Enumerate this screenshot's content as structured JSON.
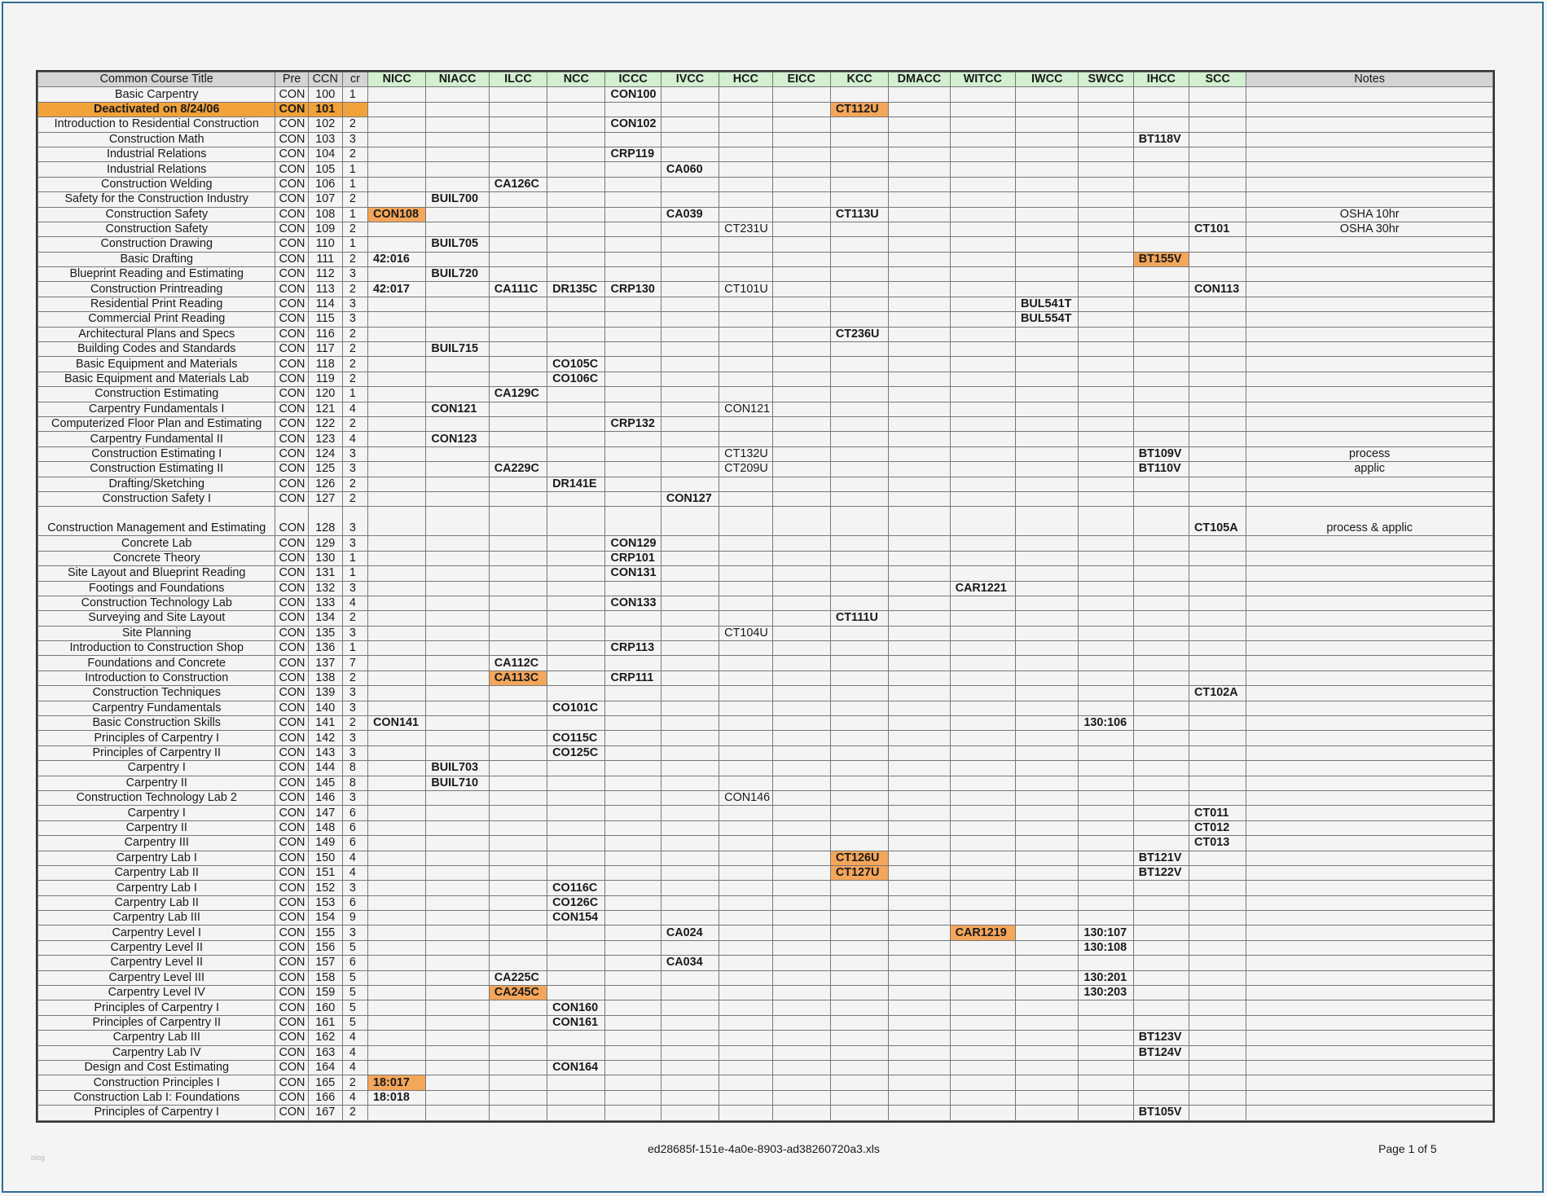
{
  "columns": {
    "title": "Common Course Title",
    "pre": "Pre",
    "ccn": "CCN",
    "cr": "cr",
    "colleges": [
      "NICC",
      "NIACC",
      "ILCC",
      "NCC",
      "ICCC",
      "IVCC",
      "HCC",
      "EICC",
      "KCC",
      "DMACC",
      "WITCC",
      "IWCC",
      "SWCC",
      "IHCC",
      "SCC"
    ],
    "notes": "Notes"
  },
  "rows": [
    {
      "title": "Basic Carpentry",
      "pre": "CON",
      "ccn": "100",
      "cr": "1",
      "ICCC": "CON100"
    },
    {
      "title": "Deactivated on 8/24/06",
      "pre": "CON",
      "ccn": "101",
      "cr": "",
      "KCC": "CT112U",
      "deactivated": true,
      "hl": [
        "KCC"
      ]
    },
    {
      "title": "Introduction to Residential Construction",
      "pre": "CON",
      "ccn": "102",
      "cr": "2",
      "ICCC": "CON102"
    },
    {
      "title": "Construction Math",
      "pre": "CON",
      "ccn": "103",
      "cr": "3",
      "IHCC": "BT118V"
    },
    {
      "title": "Industrial Relations",
      "pre": "CON",
      "ccn": "104",
      "cr": "2",
      "ICCC": "CRP119"
    },
    {
      "title": "Industrial Relations",
      "pre": "CON",
      "ccn": "105",
      "cr": "1",
      "IVCC": "CA060"
    },
    {
      "title": "Construction Welding",
      "pre": "CON",
      "ccn": "106",
      "cr": "1",
      "ILCC": "CA126C"
    },
    {
      "title": "Safety for the Construction Industry",
      "pre": "CON",
      "ccn": "107",
      "cr": "2",
      "NIACC": "BUIL700"
    },
    {
      "title": "Construction Safety",
      "pre": "CON",
      "ccn": "108",
      "cr": "1",
      "NICC": "CON108",
      "IVCC": "CA039",
      "KCC": "CT113U",
      "notes": "OSHA 10hr",
      "hl": [
        "NICC"
      ]
    },
    {
      "title": "Construction Safety",
      "pre": "CON",
      "ccn": "109",
      "cr": "2",
      "HCC": "CT231U",
      "SCC": "CT101",
      "notes": "OSHA 30hr",
      "plain": [
        "HCC"
      ]
    },
    {
      "title": "Construction Drawing",
      "pre": "CON",
      "ccn": "110",
      "cr": "1",
      "NIACC": "BUIL705"
    },
    {
      "title": "Basic Drafting",
      "pre": "CON",
      "ccn": "111",
      "cr": "2",
      "NICC": "42:016",
      "IHCC": "BT155V",
      "hl": [
        "IHCC"
      ]
    },
    {
      "title": "Blueprint Reading and Estimating",
      "pre": "CON",
      "ccn": "112",
      "cr": "3",
      "NIACC": "BUIL720"
    },
    {
      "title": "Construction Printreading",
      "pre": "CON",
      "ccn": "113",
      "cr": "2",
      "NICC": "42:017",
      "ILCC": "CA111C",
      "NCC": "DR135C",
      "ICCC": "CRP130",
      "HCC": "CT101U",
      "SCC": "CON113",
      "plain": [
        "HCC"
      ]
    },
    {
      "title": "Residential Print Reading",
      "pre": "CON",
      "ccn": "114",
      "cr": "3",
      "IWCC": "BUL541T"
    },
    {
      "title": "Commercial Print Reading",
      "pre": "CON",
      "ccn": "115",
      "cr": "3",
      "IWCC": "BUL554T"
    },
    {
      "title": "Architectural Plans and Specs",
      "pre": "CON",
      "ccn": "116",
      "cr": "2",
      "KCC": "CT236U"
    },
    {
      "title": "Building Codes and Standards",
      "pre": "CON",
      "ccn": "117",
      "cr": "2",
      "NIACC": "BUIL715"
    },
    {
      "title": "Basic Equipment and Materials",
      "pre": "CON",
      "ccn": "118",
      "cr": "2",
      "NCC": "CO105C"
    },
    {
      "title": "Basic Equipment and Materials Lab",
      "pre": "CON",
      "ccn": "119",
      "cr": "2",
      "NCC": "CO106C"
    },
    {
      "title": "Construction Estimating",
      "pre": "CON",
      "ccn": "120",
      "cr": "1",
      "ILCC": "CA129C"
    },
    {
      "title": "Carpentry Fundamentals I",
      "pre": "CON",
      "ccn": "121",
      "cr": "4",
      "NIACC": "CON121",
      "HCC": "CON121",
      "plain": [
        "HCC"
      ]
    },
    {
      "title": "Computerized Floor Plan and Estimating",
      "pre": "CON",
      "ccn": "122",
      "cr": "2",
      "ICCC": "CRP132"
    },
    {
      "title": "Carpentry Fundamental II",
      "pre": "CON",
      "ccn": "123",
      "cr": "4",
      "NIACC": "CON123"
    },
    {
      "title": "Construction Estimating I",
      "pre": "CON",
      "ccn": "124",
      "cr": "3",
      "HCC": "CT132U",
      "IHCC": "BT109V",
      "notes": "process",
      "plain": [
        "HCC"
      ]
    },
    {
      "title": "Construction Estimating II",
      "pre": "CON",
      "ccn": "125",
      "cr": "3",
      "ILCC": "CA229C",
      "HCC": "CT209U",
      "IHCC": "BT110V",
      "notes": "applic",
      "plain": [
        "HCC"
      ]
    },
    {
      "title": "Drafting/Sketching",
      "pre": "CON",
      "ccn": "126",
      "cr": "2",
      "NCC": "DR141E"
    },
    {
      "title": "Construction Safety I",
      "pre": "CON",
      "ccn": "127",
      "cr": "2",
      "IVCC": "CON127"
    },
    {
      "title": "Construction Management and Estimating",
      "pre": "CON",
      "ccn": "128",
      "cr": "3",
      "SCC": "CT105A",
      "notes": "process & applic",
      "tall": true
    },
    {
      "title": "Concrete Lab",
      "pre": "CON",
      "ccn": "129",
      "cr": "3",
      "ICCC": "CON129"
    },
    {
      "title": "Concrete Theory",
      "pre": "CON",
      "ccn": "130",
      "cr": "1",
      "ICCC": "CRP101"
    },
    {
      "title": "Site Layout and Blueprint Reading",
      "pre": "CON",
      "ccn": "131",
      "cr": "1",
      "ICCC": "CON131"
    },
    {
      "title": "Footings and Foundations",
      "pre": "CON",
      "ccn": "132",
      "cr": "3",
      "WITCC": "CAR1221"
    },
    {
      "title": "Construction Technology Lab",
      "pre": "CON",
      "ccn": "133",
      "cr": "4",
      "ICCC": "CON133"
    },
    {
      "title": "Surveying and Site Layout",
      "pre": "CON",
      "ccn": "134",
      "cr": "2",
      "KCC": "CT111U"
    },
    {
      "title": "Site Planning",
      "pre": "CON",
      "ccn": "135",
      "cr": "3",
      "HCC": "CT104U",
      "plain": [
        "HCC"
      ]
    },
    {
      "title": "Introduction to Construction Shop",
      "pre": "CON",
      "ccn": "136",
      "cr": "1",
      "ICCC": "CRP113"
    },
    {
      "title": "Foundations and Concrete",
      "pre": "CON",
      "ccn": "137",
      "cr": "7",
      "ILCC": "CA112C"
    },
    {
      "title": "Introduction to Construction",
      "pre": "CON",
      "ccn": "138",
      "cr": "2",
      "ILCC": "CA113C",
      "ICCC": "CRP111",
      "hl": [
        "ILCC"
      ]
    },
    {
      "title": "Construction Techniques",
      "pre": "CON",
      "ccn": "139",
      "cr": "3",
      "SCC": "CT102A"
    },
    {
      "title": "Carpentry Fundamentals",
      "pre": "CON",
      "ccn": "140",
      "cr": "3",
      "NCC": "CO101C"
    },
    {
      "title": "Basic Construction Skills",
      "pre": "CON",
      "ccn": "141",
      "cr": "2",
      "NICC": "CON141",
      "SWCC": "130:106"
    },
    {
      "title": "Principles of Carpentry I",
      "pre": "CON",
      "ccn": "142",
      "cr": "3",
      "NCC": "CO115C"
    },
    {
      "title": "Principles of Carpentry II",
      "pre": "CON",
      "ccn": "143",
      "cr": "3",
      "NCC": "CO125C"
    },
    {
      "title": "Carpentry I",
      "pre": "CON",
      "ccn": "144",
      "cr": "8",
      "NIACC": "BUIL703"
    },
    {
      "title": "Carpentry II",
      "pre": "CON",
      "ccn": "145",
      "cr": "8",
      "NIACC": "BUIL710"
    },
    {
      "title": "Construction Technology Lab 2",
      "pre": "CON",
      "ccn": "146",
      "cr": "3",
      "HCC": "CON146",
      "plain": [
        "HCC"
      ]
    },
    {
      "title": "Carpentry I",
      "pre": "CON",
      "ccn": "147",
      "cr": "6",
      "SCC": "CT011"
    },
    {
      "title": "Carpentry II",
      "pre": "CON",
      "ccn": "148",
      "cr": "6",
      "SCC": "CT012"
    },
    {
      "title": "Carpentry III",
      "pre": "CON",
      "ccn": "149",
      "cr": "6",
      "SCC": "CT013"
    },
    {
      "title": "Carpentry Lab I",
      "pre": "CON",
      "ccn": "150",
      "cr": "4",
      "KCC": "CT126U",
      "IHCC": "BT121V",
      "hl": [
        "KCC"
      ]
    },
    {
      "title": "Carpentry Lab II",
      "pre": "CON",
      "ccn": "151",
      "cr": "4",
      "KCC": "CT127U",
      "IHCC": "BT122V",
      "hl": [
        "KCC"
      ]
    },
    {
      "title": "Carpentry Lab I",
      "pre": "CON",
      "ccn": "152",
      "cr": "3",
      "NCC": "CO116C"
    },
    {
      "title": "Carpentry Lab II",
      "pre": "CON",
      "ccn": "153",
      "cr": "6",
      "NCC": "CO126C"
    },
    {
      "title": "Carpentry Lab III",
      "pre": "CON",
      "ccn": "154",
      "cr": "9",
      "NCC": "CON154"
    },
    {
      "title": "Carpentry Level I",
      "pre": "CON",
      "ccn": "155",
      "cr": "3",
      "IVCC": "CA024",
      "WITCC": "CAR1219",
      "SWCC": "130:107",
      "hl": [
        "WITCC"
      ]
    },
    {
      "title": "Carpentry Level II",
      "pre": "CON",
      "ccn": "156",
      "cr": "5",
      "SWCC": "130:108"
    },
    {
      "title": "Carpentry Level II",
      "pre": "CON",
      "ccn": "157",
      "cr": "6",
      "IVCC": "CA034"
    },
    {
      "title": "Carpentry Level III",
      "pre": "CON",
      "ccn": "158",
      "cr": "5",
      "ILCC": "CA225C",
      "SWCC": "130:201"
    },
    {
      "title": "Carpentry Level IV",
      "pre": "CON",
      "ccn": "159",
      "cr": "5",
      "ILCC": "CA245C",
      "SWCC": "130:203",
      "hl": [
        "ILCC"
      ]
    },
    {
      "title": "Principles of Carpentry I",
      "pre": "CON",
      "ccn": "160",
      "cr": "5",
      "NCC": "CON160"
    },
    {
      "title": "Principles of Carpentry II",
      "pre": "CON",
      "ccn": "161",
      "cr": "5",
      "NCC": "CON161"
    },
    {
      "title": "Carpentry Lab III",
      "pre": "CON",
      "ccn": "162",
      "cr": "4",
      "IHCC": "BT123V"
    },
    {
      "title": "Carpentry Lab IV",
      "pre": "CON",
      "ccn": "163",
      "cr": "4",
      "IHCC": "BT124V"
    },
    {
      "title": "Design and Cost Estimating",
      "pre": "CON",
      "ccn": "164",
      "cr": "4",
      "NCC": "CON164"
    },
    {
      "title": "Construction Principles I",
      "pre": "CON",
      "ccn": "165",
      "cr": "2",
      "NICC": "18:017",
      "hl": [
        "NICC"
      ]
    },
    {
      "title": "Construction Lab I: Foundations",
      "pre": "CON",
      "ccn": "166",
      "cr": "4",
      "NICC": "18:018"
    },
    {
      "title": "Principles of Carpentry I",
      "pre": "CON",
      "ccn": "167",
      "cr": "2",
      "IHCC": "BT105V"
    }
  ],
  "footer": {
    "filename": "ed28685f-151e-4a0e-8903-ad38260720a3.xls",
    "page": "Page 1 of 5",
    "corner_mark": "blog"
  },
  "colors": {
    "highlight": "#f4a65a",
    "deactivated_row": "#f1a23a",
    "college_header": "#d2efd0",
    "header_gray": "#d4d4d4",
    "frame": "#2f6e93"
  }
}
